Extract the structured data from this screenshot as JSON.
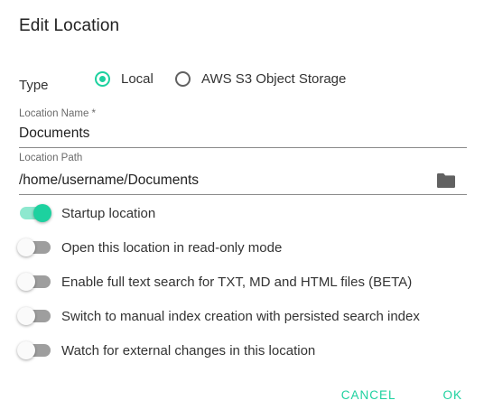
{
  "dialog": {
    "title": "Edit Location"
  },
  "type_selector": {
    "label": "Type",
    "options": [
      {
        "label": "Local",
        "checked": true
      },
      {
        "label": "AWS S3 Object Storage",
        "checked": false
      }
    ]
  },
  "location_name": {
    "label": "Location Name *",
    "value": "Documents"
  },
  "location_path": {
    "label": "Location Path",
    "value": "/home/username/Documents",
    "button_icon": "folder-icon"
  },
  "toggles": [
    {
      "label": "Startup location",
      "on": true
    },
    {
      "label": "Open this location in read-only mode",
      "on": false
    },
    {
      "label": "Enable full text search for TXT, MD and HTML files (BETA)",
      "on": false
    },
    {
      "label": "Switch to manual index creation with persisted search index",
      "on": false
    },
    {
      "label": "Watch for external changes in this location",
      "on": false
    }
  ],
  "actions": {
    "cancel_label": "CANCEL",
    "ok_label": "OK"
  },
  "colors": {
    "accent": "#1dd19f",
    "accent_light": "#8ee8cf",
    "text": "#212121",
    "muted": "#6b6b6b"
  }
}
